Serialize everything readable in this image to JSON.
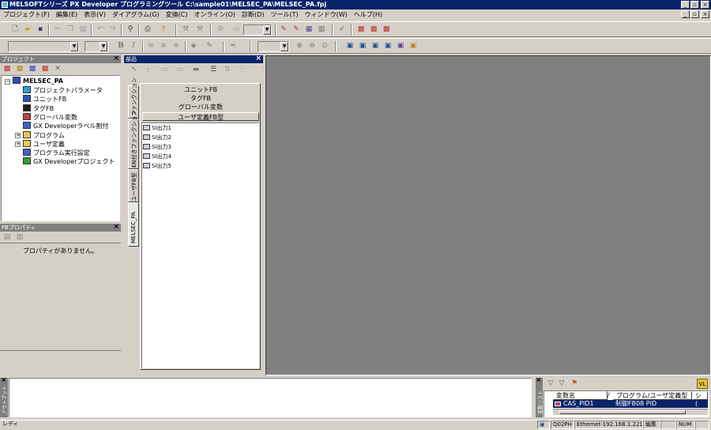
{
  "window": {
    "title": "MELSOFTシリーズ PX Developer プログラミングツール C:\\sample01\\MELSEC_PA\\MELSEC_PA.fpj"
  },
  "menu": [
    "プロジェクト(F)",
    "編集(E)",
    "表示(V)",
    "ダイアグラム(G)",
    "変換(C)",
    "オンライン(O)",
    "診断(D)",
    "ツール(T)",
    "ウィンドウ(W)",
    "ヘルプ(H)"
  ],
  "project_panel": {
    "title": "プロジェクト",
    "root": "MELSEC_PA",
    "items": [
      {
        "label": "プロジェクトパラメータ",
        "icon": "params-icon",
        "color": "#2a9fd6"
      },
      {
        "label": "ユニットFB",
        "icon": "unit-fb-icon",
        "color": "#3050c0"
      },
      {
        "label": "タグFB",
        "icon": "tag-fb-icon",
        "color": "#202020"
      },
      {
        "label": "グローバル変数",
        "icon": "global-var-icon",
        "color": "#c04040"
      },
      {
        "label": "GX Developerラベル割付",
        "icon": "label-assign-icon",
        "color": "#4060c0"
      },
      {
        "label": "プログラム",
        "icon": "folder-icon",
        "color": "#e8c850"
      },
      {
        "label": "ユーザ定義",
        "icon": "folder-icon",
        "color": "#e8c850"
      },
      {
        "label": "プログラム実行設定",
        "icon": "exec-setting-icon",
        "color": "#4060c0"
      },
      {
        "label": "GX Developerプロジェクト",
        "icon": "gx-project-icon",
        "color": "#30a030"
      }
    ]
  },
  "fb_property": {
    "title": "FBプロパティ",
    "message": "プロパティがありません。"
  },
  "parts_panel": {
    "title": "部品",
    "vertical_tabs": [
      "ファンクション",
      "EN付きファンクション",
      "ユーザFB型",
      "MELSEC_PA"
    ],
    "categories": [
      "ユニットFB",
      "タグFB",
      "グローバル変数",
      "ユーザ定義FB型"
    ],
    "items": [
      "SI出力1",
      "SI出力2",
      "SI出力3",
      "SI出力4",
      "SI出力5"
    ]
  },
  "output_panel": {
    "title": "アウトプット"
  },
  "variable_panel": {
    "title": "変数リスト",
    "columns": [
      "変数名",
      "/",
      "プログラム/ユーザ定義型",
      "シ"
    ],
    "rows": [
      {
        "name": "CAS_PID1",
        "type": "制御FB08 PID",
        "extra": "("
      }
    ]
  },
  "status_bar": {
    "status": "レディ",
    "cpu": "Q02PH",
    "connection": "Ethernet-192.168.1.221",
    "mode": "編集",
    "num": "NUM"
  },
  "colors": {
    "title_bar": "#0a246a",
    "workspace": "#808080",
    "selection": "#0a246a"
  }
}
